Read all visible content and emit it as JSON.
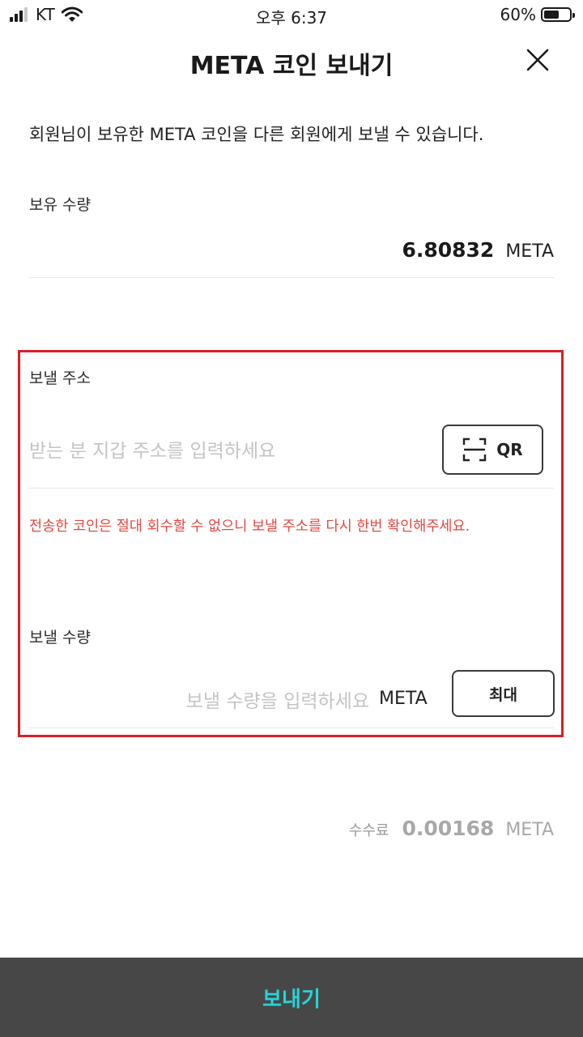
{
  "status_bar": {
    "carrier": "KT",
    "time": "오후 6:37",
    "battery_percent": "60%",
    "battery_level": 0.6,
    "icons": [
      "signal-icon",
      "wifi-icon",
      "battery-icon"
    ]
  },
  "header": {
    "title": "META 코인 보내기",
    "close_icon": "close-icon"
  },
  "intro": "회원님이 보유한 META 코인을 다른 회원에게 보낼 수 있습니다.",
  "holdings": {
    "label": "보유 수량",
    "value": "6.80832",
    "unit": "META"
  },
  "send_address": {
    "label": "보낼 주소",
    "placeholder": "받는 분 지갑 주소를 입력하세요",
    "value": "",
    "qr_button_label": "QR",
    "qr_icon": "qr-scan-icon",
    "warning": "전송한 코인은 절대 회수할 수 없으니 보낼 주소를 다시 한번 확인해주세요."
  },
  "send_amount": {
    "label": "보낼 수량",
    "placeholder": "보낼 수량을 입력하세요",
    "value": "",
    "unit": "META",
    "max_button_label": "최대"
  },
  "fee": {
    "label": "수수료",
    "value": "0.00168",
    "unit": "META"
  },
  "send_button_label": "보내기",
  "colors": {
    "highlight_border": "#d6202a",
    "warning_text": "#e8463f",
    "send_bar_bg": "#474747",
    "send_label": "#28d3d6"
  }
}
